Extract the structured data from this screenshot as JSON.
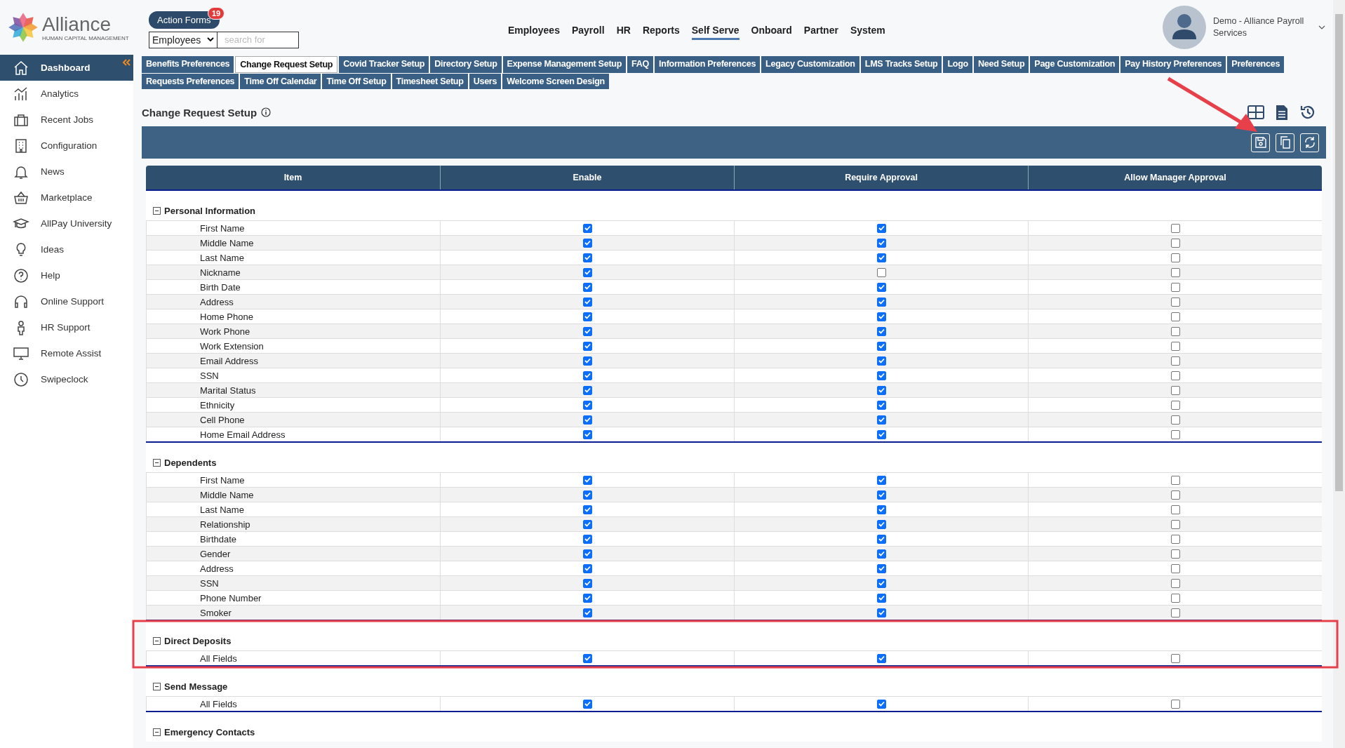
{
  "logo": {
    "name": "Alliance",
    "tagline": "HUMAN CAPITAL MANAGEMENT"
  },
  "action_forms": {
    "label": "Action Forms",
    "badge": "19"
  },
  "search": {
    "scope": "Employees",
    "placeholder": "search for"
  },
  "top_nav": [
    {
      "label": "Employees",
      "selected": false
    },
    {
      "label": "Payroll",
      "selected": false
    },
    {
      "label": "HR",
      "selected": false
    },
    {
      "label": "Reports",
      "selected": false
    },
    {
      "label": "Self Serve",
      "selected": true
    },
    {
      "label": "Onboard",
      "selected": false
    },
    {
      "label": "Partner",
      "selected": false
    },
    {
      "label": "System",
      "selected": false
    }
  ],
  "user": {
    "name": "Demo - Alliance Payroll Services"
  },
  "sidebar": {
    "items": [
      {
        "label": "Dashboard",
        "selected": true
      },
      {
        "label": "Analytics",
        "selected": false
      },
      {
        "label": "Recent Jobs",
        "selected": false
      },
      {
        "label": "Configuration",
        "selected": false
      },
      {
        "label": "News",
        "selected": false
      },
      {
        "label": "Marketplace",
        "selected": false
      },
      {
        "label": "AllPay University",
        "selected": false
      },
      {
        "label": "Ideas",
        "selected": false
      },
      {
        "label": "Help",
        "selected": false
      },
      {
        "label": "Online Support",
        "selected": false
      },
      {
        "label": "HR Support",
        "selected": false
      },
      {
        "label": "Remote Assist",
        "selected": false
      },
      {
        "label": "Swipeclock",
        "selected": false
      }
    ]
  },
  "tab_rows": [
    [
      {
        "label": "Benefits Preferences",
        "selected": false
      },
      {
        "label": "Change Request Setup",
        "selected": true
      },
      {
        "label": "Covid Tracker Setup",
        "selected": false
      },
      {
        "label": "Directory Setup",
        "selected": false
      },
      {
        "label": "Expense Management Setup",
        "selected": false
      },
      {
        "label": "FAQ",
        "selected": false
      },
      {
        "label": "Information Preferences",
        "selected": false
      },
      {
        "label": "Legacy Customization",
        "selected": false
      },
      {
        "label": "LMS Tracks Setup",
        "selected": false
      },
      {
        "label": "Logo",
        "selected": false
      },
      {
        "label": "Need Setup",
        "selected": false
      },
      {
        "label": "Page Customization",
        "selected": false
      },
      {
        "label": "Pay History Preferences",
        "selected": false
      },
      {
        "label": "Preferences",
        "selected": false
      }
    ],
    [
      {
        "label": "Requests Preferences",
        "selected": false
      },
      {
        "label": "Time Off Calendar",
        "selected": false
      },
      {
        "label": "Time Off Setup",
        "selected": false
      },
      {
        "label": "Timesheet Setup",
        "selected": false
      },
      {
        "label": "Users",
        "selected": false
      },
      {
        "label": "Welcome Screen Design",
        "selected": false
      }
    ]
  ],
  "page_title": "Change Request Setup",
  "table": {
    "columns": [
      "Item",
      "Enable",
      "Require Approval",
      "Allow Manager Approval"
    ],
    "sections": [
      {
        "title": "Personal Information",
        "expanded": true,
        "rows": [
          {
            "item": "First Name",
            "enable": true,
            "require_approval": true,
            "allow_manager_approval": false
          },
          {
            "item": "Middle Name",
            "enable": true,
            "require_approval": true,
            "allow_manager_approval": false
          },
          {
            "item": "Last Name",
            "enable": true,
            "require_approval": true,
            "allow_manager_approval": false
          },
          {
            "item": "Nickname",
            "enable": true,
            "require_approval": false,
            "allow_manager_approval": false
          },
          {
            "item": "Birth Date",
            "enable": true,
            "require_approval": true,
            "allow_manager_approval": false
          },
          {
            "item": "Address",
            "enable": true,
            "require_approval": true,
            "allow_manager_approval": false
          },
          {
            "item": "Home Phone",
            "enable": true,
            "require_approval": true,
            "allow_manager_approval": false
          },
          {
            "item": "Work Phone",
            "enable": true,
            "require_approval": true,
            "allow_manager_approval": false
          },
          {
            "item": "Work Extension",
            "enable": true,
            "require_approval": true,
            "allow_manager_approval": false
          },
          {
            "item": "Email Address",
            "enable": true,
            "require_approval": true,
            "allow_manager_approval": false
          },
          {
            "item": "SSN",
            "enable": true,
            "require_approval": true,
            "allow_manager_approval": false
          },
          {
            "item": "Marital Status",
            "enable": true,
            "require_approval": true,
            "allow_manager_approval": false
          },
          {
            "item": "Ethnicity",
            "enable": true,
            "require_approval": true,
            "allow_manager_approval": false
          },
          {
            "item": "Cell Phone",
            "enable": true,
            "require_approval": true,
            "allow_manager_approval": false
          },
          {
            "item": "Home Email Address",
            "enable": true,
            "require_approval": true,
            "allow_manager_approval": false
          }
        ]
      },
      {
        "title": "Dependents",
        "expanded": true,
        "rows": [
          {
            "item": "First Name",
            "enable": true,
            "require_approval": true,
            "allow_manager_approval": false
          },
          {
            "item": "Middle Name",
            "enable": true,
            "require_approval": true,
            "allow_manager_approval": false
          },
          {
            "item": "Last Name",
            "enable": true,
            "require_approval": true,
            "allow_manager_approval": false
          },
          {
            "item": "Relationship",
            "enable": true,
            "require_approval": true,
            "allow_manager_approval": false
          },
          {
            "item": "Birthdate",
            "enable": true,
            "require_approval": true,
            "allow_manager_approval": false
          },
          {
            "item": "Gender",
            "enable": true,
            "require_approval": true,
            "allow_manager_approval": false
          },
          {
            "item": "Address",
            "enable": true,
            "require_approval": true,
            "allow_manager_approval": false
          },
          {
            "item": "SSN",
            "enable": true,
            "require_approval": true,
            "allow_manager_approval": false
          },
          {
            "item": "Phone Number",
            "enable": true,
            "require_approval": true,
            "allow_manager_approval": false
          },
          {
            "item": "Smoker",
            "enable": true,
            "require_approval": true,
            "allow_manager_approval": false
          }
        ]
      },
      {
        "title": "Direct Deposits",
        "expanded": true,
        "rows": [
          {
            "item": "All Fields",
            "enable": true,
            "require_approval": true,
            "allow_manager_approval": false
          }
        ]
      },
      {
        "title": "Send Message",
        "expanded": true,
        "rows": [
          {
            "item": "All Fields",
            "enable": true,
            "require_approval": true,
            "allow_manager_approval": false
          }
        ]
      },
      {
        "title": "Emergency Contacts",
        "expanded": true
      }
    ]
  }
}
